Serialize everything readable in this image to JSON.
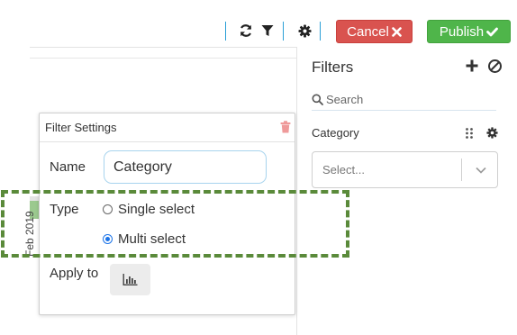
{
  "toolbar": {
    "cancel_label": "Cancel",
    "publish_label": "Publish",
    "icons": [
      "refresh-icon",
      "filter-icon",
      "gear-icon"
    ],
    "colors": {
      "cancel": "#d9534f",
      "publish": "#4fb54a",
      "separator": "#2a9fd6"
    }
  },
  "canvas": {
    "axis_label": "Feb 2019"
  },
  "filters_panel": {
    "title": "Filters",
    "search_placeholder": "Search",
    "category": {
      "label": "Category",
      "select_placeholder": "Select..."
    }
  },
  "filter_settings": {
    "title": "Filter Settings",
    "name_label": "Name",
    "name_value": "Category",
    "type_label": "Type",
    "type_options": [
      {
        "label": "Single select",
        "selected": false
      },
      {
        "label": "Multi select",
        "selected": true
      }
    ],
    "apply_label": "Apply to",
    "apply_icon": "bar-chart-icon"
  },
  "highlight_color": "#5a8a3a"
}
